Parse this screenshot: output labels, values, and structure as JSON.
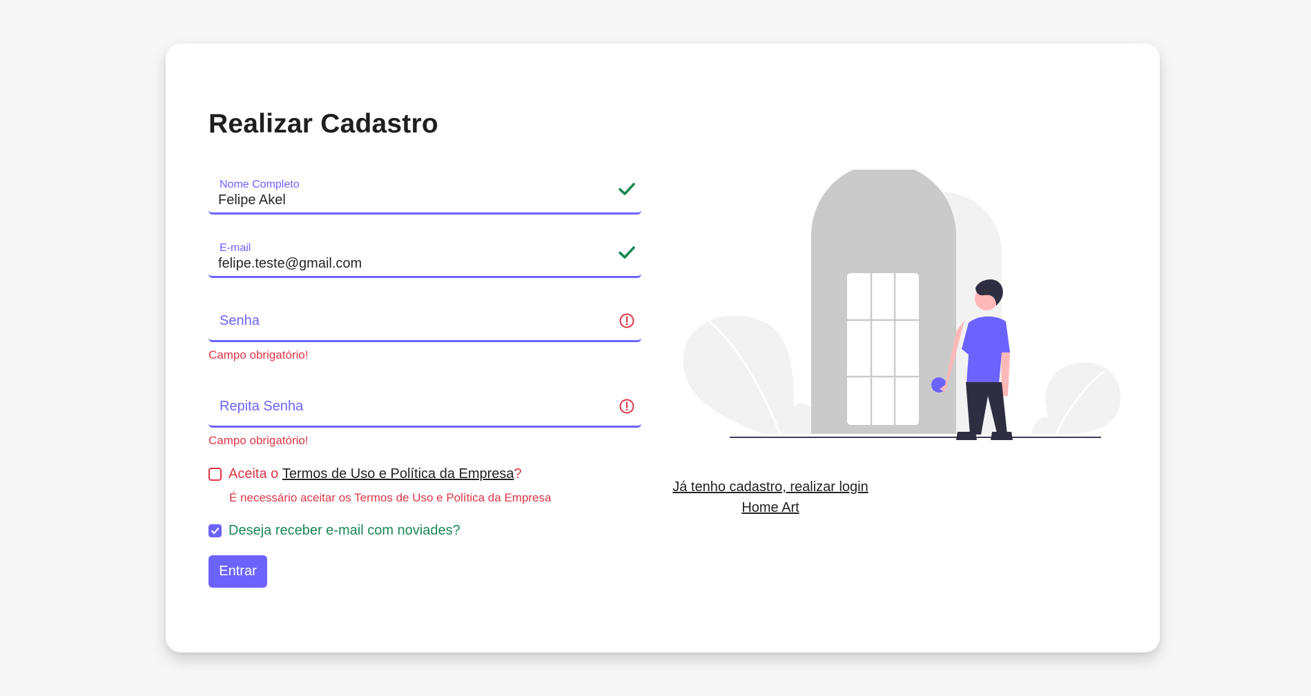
{
  "form": {
    "title": "Realizar Cadastro",
    "name_field": {
      "label": "Nome Completo",
      "value": "Felipe Akel",
      "status": "valid"
    },
    "email_field": {
      "label": "E-mail",
      "value": "felipe.teste@gmail.com",
      "status": "valid"
    },
    "password_field": {
      "placeholder": "Senha",
      "status": "invalid",
      "error": "Campo obrigatório!"
    },
    "repeat_password_field": {
      "placeholder": "Repita Senha",
      "status": "invalid",
      "error": "Campo obrigatório!"
    },
    "terms": {
      "prefix": "Aceita o ",
      "link": "Termos de Uso e Política da Empresa",
      "suffix": "?",
      "checked": false,
      "error": "É necessário aceitar os Termos de Uso e Política da Empresa"
    },
    "newsletter": {
      "label": "Deseja receber e-mail com noviades?",
      "checked": true
    },
    "submit_label": "Entrar"
  },
  "side": {
    "login_link": "Já tenho cadastro, realizar login",
    "home_link": "Home Art"
  },
  "colors": {
    "accent": "#6c63ff",
    "valid": "#198754",
    "error": "#dc3545",
    "background": "#f7f7f7",
    "card": "#ffffff"
  },
  "icons": {
    "valid": "check-icon",
    "invalid": "exclamation-circle-icon",
    "checkbox_checked": "checkmark-icon"
  }
}
